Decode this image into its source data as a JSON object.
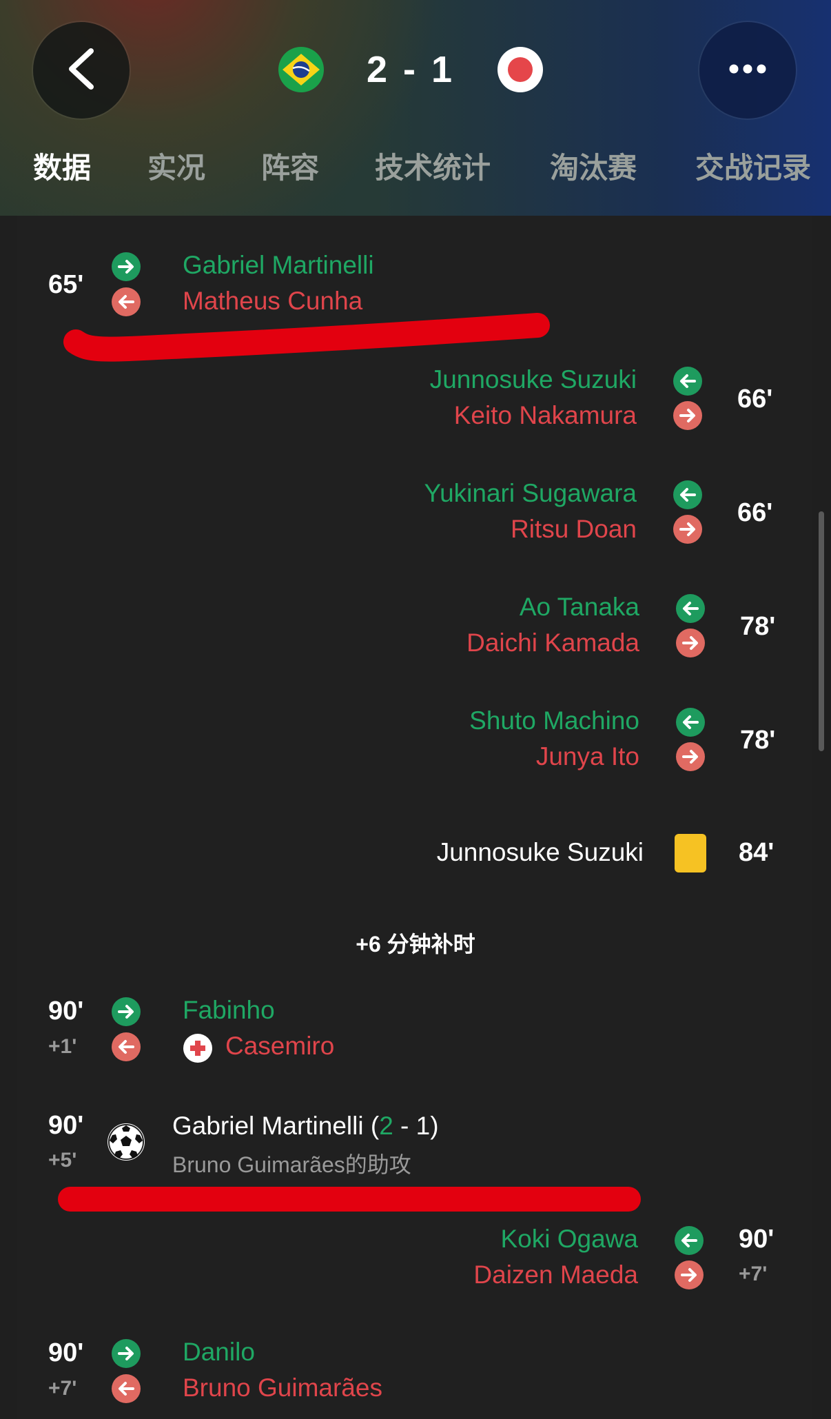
{
  "header": {
    "score": "2 - 1",
    "home_flag_icon": "brazil-flag-icon",
    "away_flag_icon": "japan-flag-icon",
    "tabs": [
      "数据",
      "实况",
      "阵容",
      "技术统计",
      "淘汰赛",
      "交战记录"
    ],
    "active_tab": "数据"
  },
  "events": {
    "e1": {
      "minute": "65'",
      "in": "Gabriel Martinelli",
      "out": "Matheus Cunha"
    },
    "e2": {
      "minute": "66'",
      "in": "Junnosuke Suzuki",
      "out": "Keito Nakamura"
    },
    "e3": {
      "minute": "66'",
      "in": "Yukinari Sugawara",
      "out": "Ritsu Doan"
    },
    "e4": {
      "minute": "78'",
      "in": "Ao Tanaka",
      "out": "Daichi Kamada"
    },
    "e5": {
      "minute": "78'",
      "in": "Shuto Machino",
      "out": "Junya Ito"
    },
    "e6": {
      "minute": "84'",
      "player": "Junnosuke Suzuki",
      "card": "yellow-card-icon"
    },
    "added_time": "+6 分钟补时",
    "e7": {
      "minute": "90'",
      "extra": "+1'",
      "in": "Fabinho",
      "out": "Casemiro",
      "note_icon": "injury-icon"
    },
    "e8": {
      "minute": "90'",
      "extra": "+5'",
      "scorer": "Gabriel Martinelli",
      "score_open": "(",
      "score_home": "2",
      "score_rest": " - 1)",
      "assist": "Bruno Guimarães的助攻"
    },
    "e9": {
      "minute": "90'",
      "extra": "+7'",
      "in": "Koki Ogawa",
      "out": "Daizen Maeda"
    },
    "e10": {
      "minute": "90'",
      "extra": "+7'",
      "in": "Danilo",
      "out": "Bruno Guimarães"
    }
  },
  "colors": {
    "in": "#1fa864",
    "out": "#e0454b",
    "highlight_mark": "#e3000f",
    "yellow_card": "#f6c223"
  }
}
